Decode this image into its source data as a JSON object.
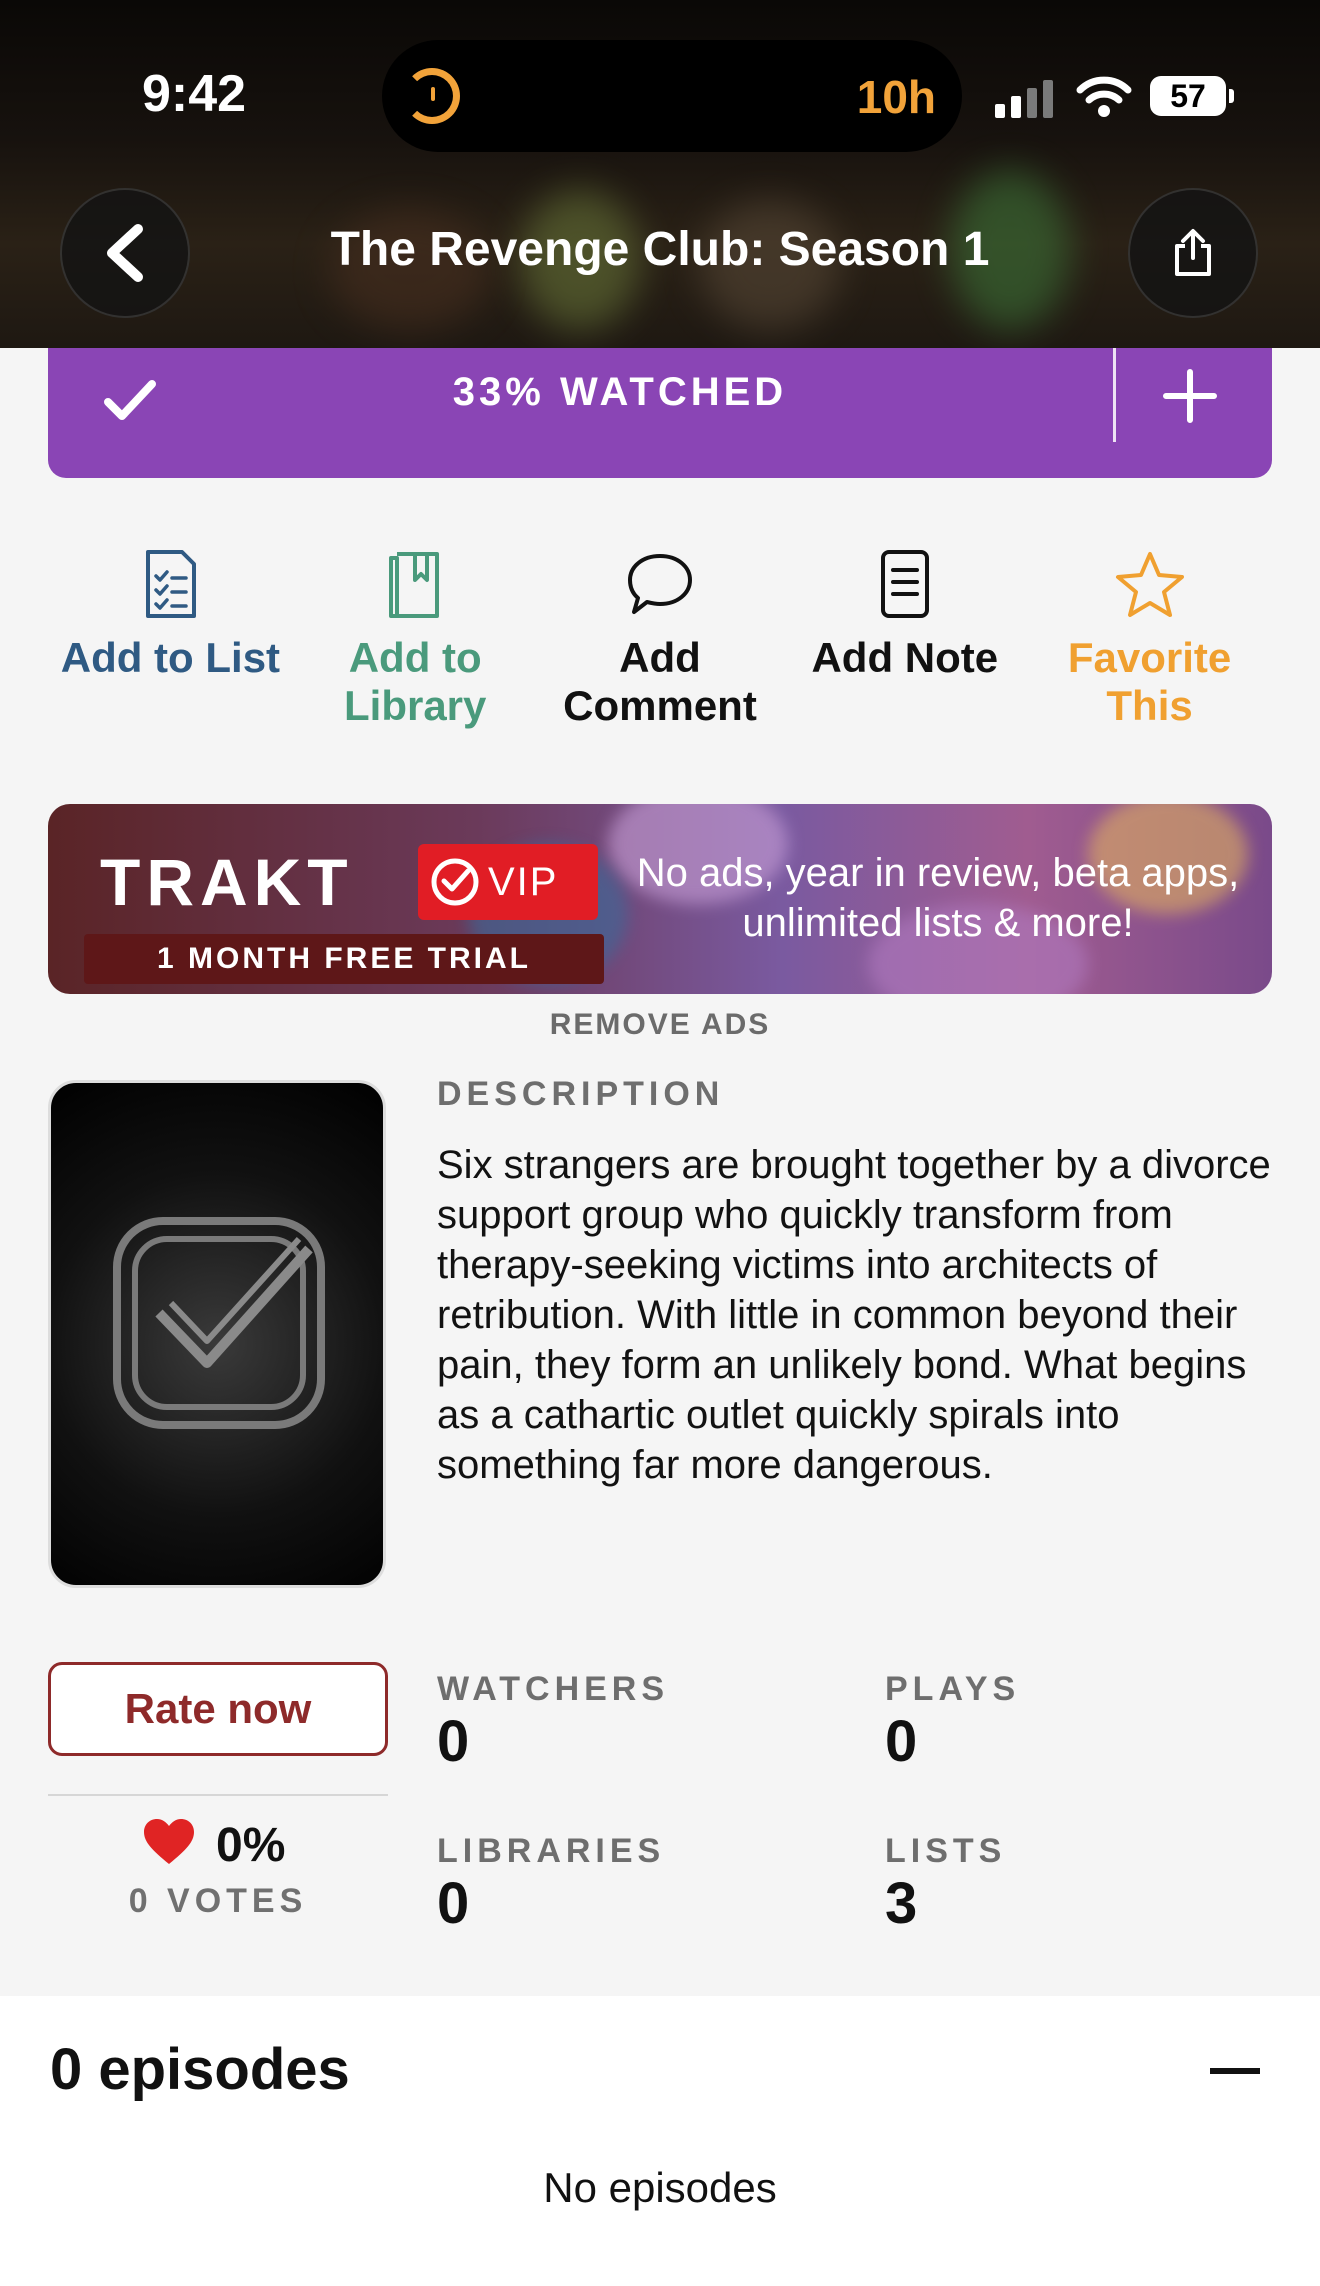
{
  "status_bar": {
    "time": "9:42",
    "activity": "10h",
    "battery": "57"
  },
  "header": {
    "title": "The Revenge Club: Season 1"
  },
  "progress": {
    "label": "33% WATCHED",
    "percent": 33
  },
  "actions": [
    {
      "label": "Add to List",
      "color": "#2f5a83",
      "icon": "checklist-icon"
    },
    {
      "label": "Add to Library",
      "color": "#4a9a7c",
      "icon": "library-icon"
    },
    {
      "label": "Add Comment",
      "color": "#111111",
      "icon": "comment-icon"
    },
    {
      "label": "Add Note",
      "color": "#111111",
      "icon": "note-icon"
    },
    {
      "label": "Favorite This",
      "color": "#f0a030",
      "icon": "star-icon"
    }
  ],
  "banner": {
    "brand": "TRAKT",
    "badge": "VIP",
    "trial": "1 MONTH FREE TRIAL",
    "tagline": "No ads, year in review, beta apps, unlimited lists & more!",
    "remove_ads": "REMOVE ADS"
  },
  "description": {
    "heading": "DESCRIPTION",
    "text": "Six strangers are brought together by a divorce support group who quickly transform from therapy-seeking victims into architects of retribution. With little in common beyond their pain, they form an unlikely bond. What begins as a cathartic outlet quickly spirals into something far more dangerous."
  },
  "rating": {
    "button": "Rate now",
    "percent": "0%",
    "votes": "0 VOTES"
  },
  "stats": {
    "watchers": {
      "label": "WATCHERS",
      "value": "0"
    },
    "plays": {
      "label": "PLAYS",
      "value": "0"
    },
    "libraries": {
      "label": "LIBRARIES",
      "value": "0"
    },
    "lists": {
      "label": "LISTS",
      "value": "3"
    }
  },
  "episodes": {
    "title": "0 episodes",
    "empty": "No episodes"
  },
  "colors": {
    "accent_purple": "#8a45b5",
    "rate_red": "#8e2a2a",
    "heart": "#e02424"
  }
}
